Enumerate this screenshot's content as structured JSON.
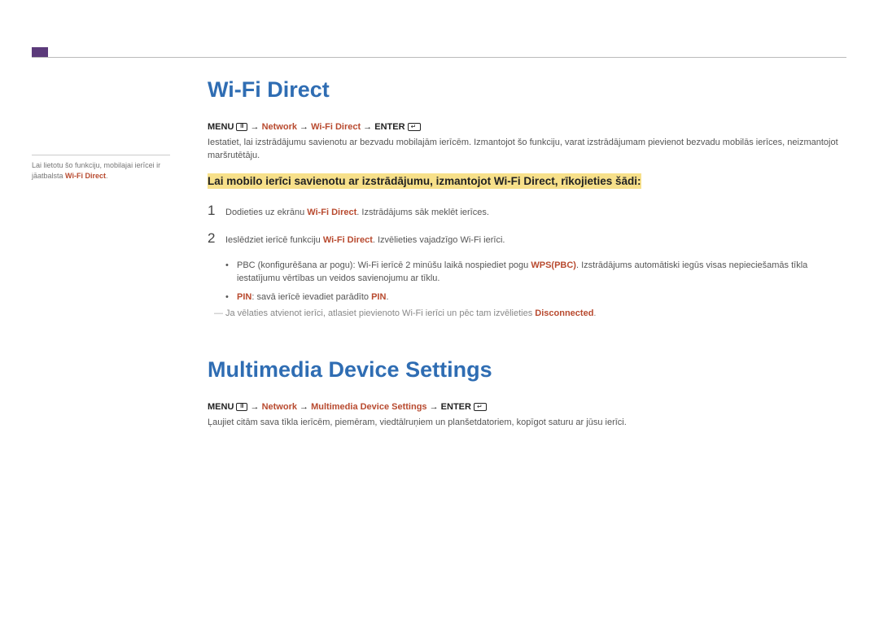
{
  "sideNote": {
    "pre": "Lai lietotu šo funkciju, mobilajai ierīcei ir jāatbalsta ",
    "hl": "Wi-Fi Direct",
    "post": "."
  },
  "section1": {
    "title": "Wi-Fi Direct",
    "menu": {
      "menu": "MENU",
      "arrow": " → ",
      "p1": "Network",
      "p2": "Wi-Fi Direct",
      "enter": "ENTER"
    },
    "intro": "Iestatiet, lai izstrādājumu savienotu ar bezvadu mobilajām ierīcēm. Izmantojot šo funkciju, varat izstrādājumam pievienot bezvadu mobilās ierīces, neizmantojot maršrutētāju.",
    "highlight": "Lai mobilo ierīci savienotu ar izstrādājumu, izmantojot Wi-Fi Direct, rīkojieties šādi:",
    "step1": {
      "num": "1",
      "a": "Dodieties uz ekrānu ",
      "red": "Wi-Fi Direct",
      "b": ". Izstrādājums sāk meklēt ierīces."
    },
    "step2": {
      "num": "2",
      "a": "Ieslēdziet ierīcē funkciju ",
      "red": "Wi-Fi Direct",
      "b": ". Izvēlieties vajadzīgo Wi-Fi ierīci."
    },
    "bullet1": {
      "a": "PBC (konfigurēšana ar pogu): Wi-Fi ierīcē 2 minūšu laikā nospiediet pogu ",
      "red": "WPS(PBC)",
      "b": ". Izstrādājums automātiski iegūs visas nepieciešamās tīkla iestatījumu vērtības un veidos savienojumu ar tīklu."
    },
    "bullet2": {
      "red1": "PIN",
      "a": ": savā ierīcē ievadiet parādīto ",
      "red2": "PIN",
      "b": "."
    },
    "note": {
      "dash": "―",
      "a": "Ja vēlaties atvienot ierīci, atlasiet pievienoto Wi-Fi ierīci un pēc tam izvēlieties ",
      "red": "Disconnected",
      "b": "."
    }
  },
  "section2": {
    "title": "Multimedia Device Settings",
    "menu": {
      "menu": "MENU",
      "arrow": " → ",
      "p1": "Network",
      "p2": "Multimedia Device Settings",
      "enter": "ENTER"
    },
    "body": "Ļaujiet citām sava tīkla ierīcēm, piemēram, viedtālruņiem un planšetdatoriem, kopīgot saturu ar jūsu ierīci."
  }
}
